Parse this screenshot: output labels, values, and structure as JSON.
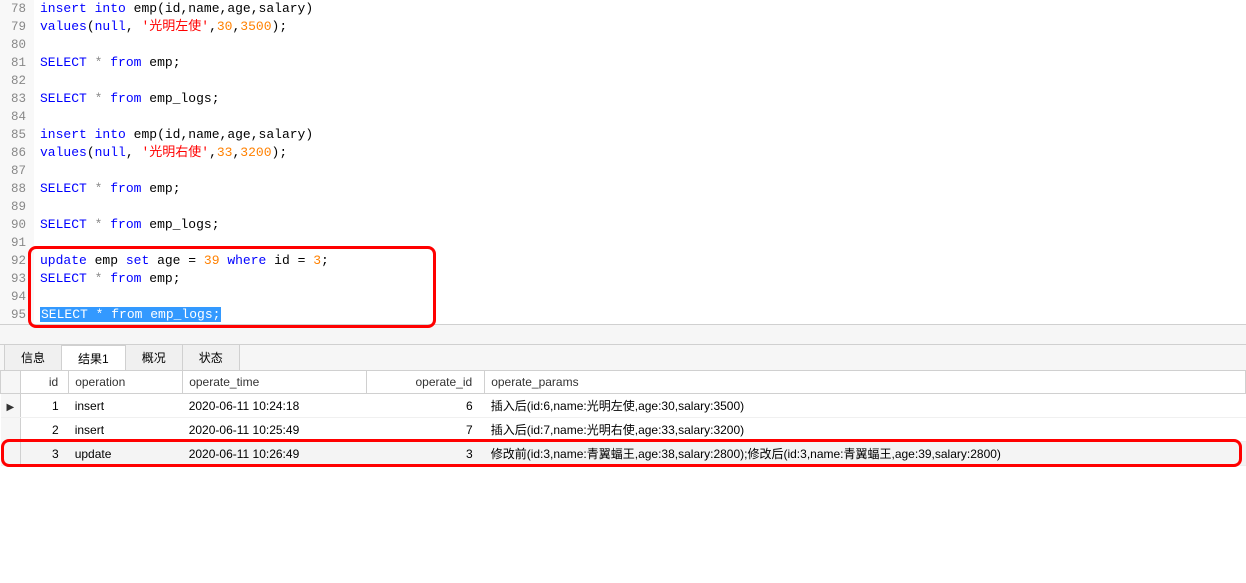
{
  "code_lines": [
    {
      "n": 78,
      "tokens": [
        [
          "kw",
          "insert"
        ],
        [
          "punct",
          " "
        ],
        [
          "kw",
          "into"
        ],
        [
          "punct",
          " "
        ],
        [
          "ident",
          "emp"
        ],
        [
          "punct",
          "("
        ],
        [
          "ident",
          "id"
        ],
        [
          "punct",
          ","
        ],
        [
          "ident",
          "name"
        ],
        [
          "punct",
          ","
        ],
        [
          "ident",
          "age"
        ],
        [
          "punct",
          ","
        ],
        [
          "ident",
          "salary"
        ],
        [
          "punct",
          ")"
        ]
      ]
    },
    {
      "n": 79,
      "tokens": [
        [
          "kw",
          "values"
        ],
        [
          "punct",
          "("
        ],
        [
          "kw",
          "null"
        ],
        [
          "punct",
          ", "
        ],
        [
          "str",
          "'光明左使'"
        ],
        [
          "punct",
          ","
        ],
        [
          "num",
          "30"
        ],
        [
          "punct",
          ","
        ],
        [
          "num",
          "3500"
        ],
        [
          "punct",
          ");"
        ]
      ]
    },
    {
      "n": 80,
      "tokens": []
    },
    {
      "n": 81,
      "tokens": [
        [
          "kw",
          "SELECT"
        ],
        [
          "punct",
          " "
        ],
        [
          "star",
          "*"
        ],
        [
          "punct",
          " "
        ],
        [
          "kw",
          "from"
        ],
        [
          "punct",
          " "
        ],
        [
          "ident",
          "emp"
        ],
        [
          "punct",
          ";"
        ]
      ]
    },
    {
      "n": 82,
      "tokens": []
    },
    {
      "n": 83,
      "tokens": [
        [
          "kw",
          "SELECT"
        ],
        [
          "punct",
          " "
        ],
        [
          "star",
          "*"
        ],
        [
          "punct",
          " "
        ],
        [
          "kw",
          "from"
        ],
        [
          "punct",
          " "
        ],
        [
          "ident",
          "emp_logs"
        ],
        [
          "punct",
          ";"
        ]
      ]
    },
    {
      "n": 84,
      "tokens": []
    },
    {
      "n": 85,
      "tokens": [
        [
          "kw",
          "insert"
        ],
        [
          "punct",
          " "
        ],
        [
          "kw",
          "into"
        ],
        [
          "punct",
          " "
        ],
        [
          "ident",
          "emp"
        ],
        [
          "punct",
          "("
        ],
        [
          "ident",
          "id"
        ],
        [
          "punct",
          ","
        ],
        [
          "ident",
          "name"
        ],
        [
          "punct",
          ","
        ],
        [
          "ident",
          "age"
        ],
        [
          "punct",
          ","
        ],
        [
          "ident",
          "salary"
        ],
        [
          "punct",
          ")"
        ]
      ]
    },
    {
      "n": 86,
      "tokens": [
        [
          "kw",
          "values"
        ],
        [
          "punct",
          "("
        ],
        [
          "kw",
          "null"
        ],
        [
          "punct",
          ", "
        ],
        [
          "str",
          "'光明右使'"
        ],
        [
          "punct",
          ","
        ],
        [
          "num",
          "33"
        ],
        [
          "punct",
          ","
        ],
        [
          "num",
          "3200"
        ],
        [
          "punct",
          ");"
        ]
      ]
    },
    {
      "n": 87,
      "tokens": []
    },
    {
      "n": 88,
      "tokens": [
        [
          "kw",
          "SELECT"
        ],
        [
          "punct",
          " "
        ],
        [
          "star",
          "*"
        ],
        [
          "punct",
          " "
        ],
        [
          "kw",
          "from"
        ],
        [
          "punct",
          " "
        ],
        [
          "ident",
          "emp"
        ],
        [
          "punct",
          ";"
        ]
      ]
    },
    {
      "n": 89,
      "tokens": []
    },
    {
      "n": 90,
      "tokens": [
        [
          "kw",
          "SELECT"
        ],
        [
          "punct",
          " "
        ],
        [
          "star",
          "*"
        ],
        [
          "punct",
          " "
        ],
        [
          "kw",
          "from"
        ],
        [
          "punct",
          " "
        ],
        [
          "ident",
          "emp_logs"
        ],
        [
          "punct",
          ";"
        ]
      ]
    },
    {
      "n": 91,
      "tokens": []
    },
    {
      "n": 92,
      "tokens": [
        [
          "kw",
          "update"
        ],
        [
          "punct",
          " "
        ],
        [
          "ident",
          "emp"
        ],
        [
          "punct",
          " "
        ],
        [
          "kw",
          "set"
        ],
        [
          "punct",
          " "
        ],
        [
          "ident",
          "age"
        ],
        [
          "punct",
          " "
        ],
        [
          "punct",
          "="
        ],
        [
          "punct",
          " "
        ],
        [
          "num",
          "39"
        ],
        [
          "punct",
          " "
        ],
        [
          "kw",
          "where"
        ],
        [
          "punct",
          " "
        ],
        [
          "ident",
          "id"
        ],
        [
          "punct",
          " "
        ],
        [
          "punct",
          "="
        ],
        [
          "punct",
          " "
        ],
        [
          "num",
          "3"
        ],
        [
          "punct",
          ";"
        ]
      ]
    },
    {
      "n": 93,
      "tokens": [
        [
          "kw",
          "SELECT"
        ],
        [
          "punct",
          " "
        ],
        [
          "star",
          "*"
        ],
        [
          "punct",
          " "
        ],
        [
          "kw",
          "from"
        ],
        [
          "punct",
          " "
        ],
        [
          "ident",
          "emp"
        ],
        [
          "punct",
          ";"
        ]
      ]
    },
    {
      "n": 94,
      "tokens": []
    },
    {
      "n": 95,
      "tokens": [
        [
          "sel",
          "SELECT * from emp_logs;"
        ]
      ]
    }
  ],
  "tabs": {
    "items": [
      "信息",
      "结果1",
      "概况",
      "状态"
    ],
    "active_index": 1
  },
  "table": {
    "headers": [
      "id",
      "operation",
      "operate_time",
      "operate_id",
      "operate_params"
    ],
    "rows": [
      {
        "id": "1",
        "operation": "insert",
        "operate_time": "2020-06-11 10:24:18",
        "operate_id": "6",
        "operate_params": "插入后(id:6,name:光明左使,age:30,salary:3500)"
      },
      {
        "id": "2",
        "operation": "insert",
        "operate_time": "2020-06-11 10:25:49",
        "operate_id": "7",
        "operate_params": "插入后(id:7,name:光明右使,age:33,salary:3200)"
      },
      {
        "id": "3",
        "operation": "update",
        "operate_time": "2020-06-11 10:26:49",
        "operate_id": "3",
        "operate_params": "修改前(id:3,name:青翼蝠王,age:38,salary:2800);修改后(id:3,name:青翼蝠王,age:39,salary:2800)"
      }
    ]
  },
  "row_marker": "▶"
}
